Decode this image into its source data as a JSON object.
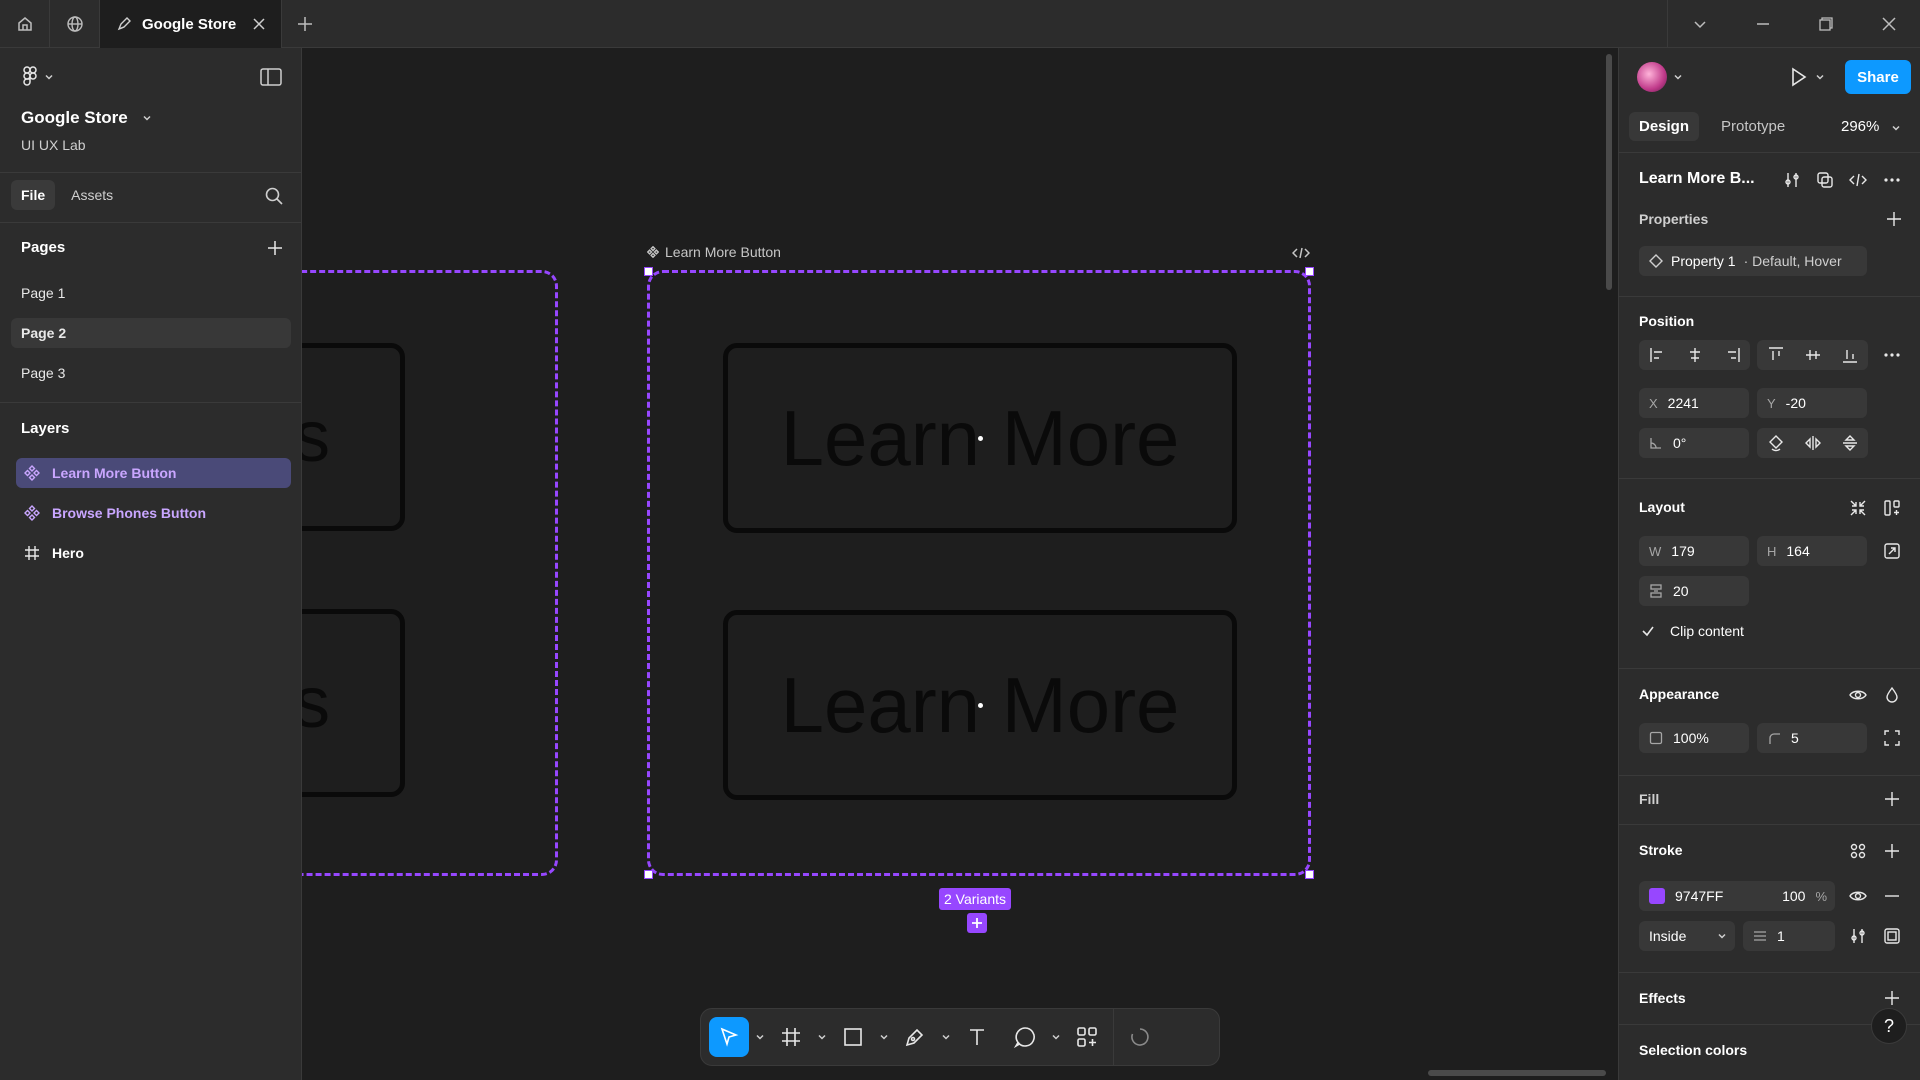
{
  "tab": {
    "title": "Google Store"
  },
  "file": {
    "name": "Google Store",
    "team": "UI UX Lab"
  },
  "left_tabs": [
    "File",
    "Assets"
  ],
  "pages": {
    "heading": "Pages",
    "items": [
      "Page 1",
      "Page 2",
      "Page 3"
    ],
    "active": "Page 2"
  },
  "layers": {
    "heading": "Layers",
    "items": [
      "Learn More Button",
      "Browse Phones Button",
      "Hero"
    ]
  },
  "canvas": {
    "component_label": "Learn More Button",
    "button_text": "Learn More",
    "left_partial_text": "nes",
    "variants_badge": "2 Variants"
  },
  "right": {
    "share": "Share",
    "tabs": [
      "Design",
      "Prototype"
    ],
    "zoom": "296%",
    "component_name": "Learn More B...",
    "properties": {
      "heading": "Properties",
      "name": "Property 1",
      "values": "· Default, Hover"
    },
    "position": {
      "heading": "Position",
      "x_label": "X",
      "x": "2241",
      "y_label": "Y",
      "y": "-20",
      "rotation": "0°"
    },
    "layout": {
      "heading": "Layout",
      "w_label": "W",
      "w": "179",
      "h_label": "H",
      "h": "164",
      "gap": "20",
      "clip": "Clip content"
    },
    "appearance": {
      "heading": "Appearance",
      "opacity": "100%",
      "radius": "5"
    },
    "fill": {
      "heading": "Fill"
    },
    "stroke": {
      "heading": "Stroke",
      "color": "9747FF",
      "opacity": "100",
      "unit": "%",
      "position": "Inside",
      "weight": "1"
    },
    "effects": {
      "heading": "Effects"
    },
    "selection_colors": {
      "heading": "Selection colors"
    },
    "help": "?"
  },
  "colors": {
    "accent": "#9747ff",
    "primary": "#0d99ff",
    "bg": "#1e1e1e",
    "panel": "#2c2c2c"
  }
}
